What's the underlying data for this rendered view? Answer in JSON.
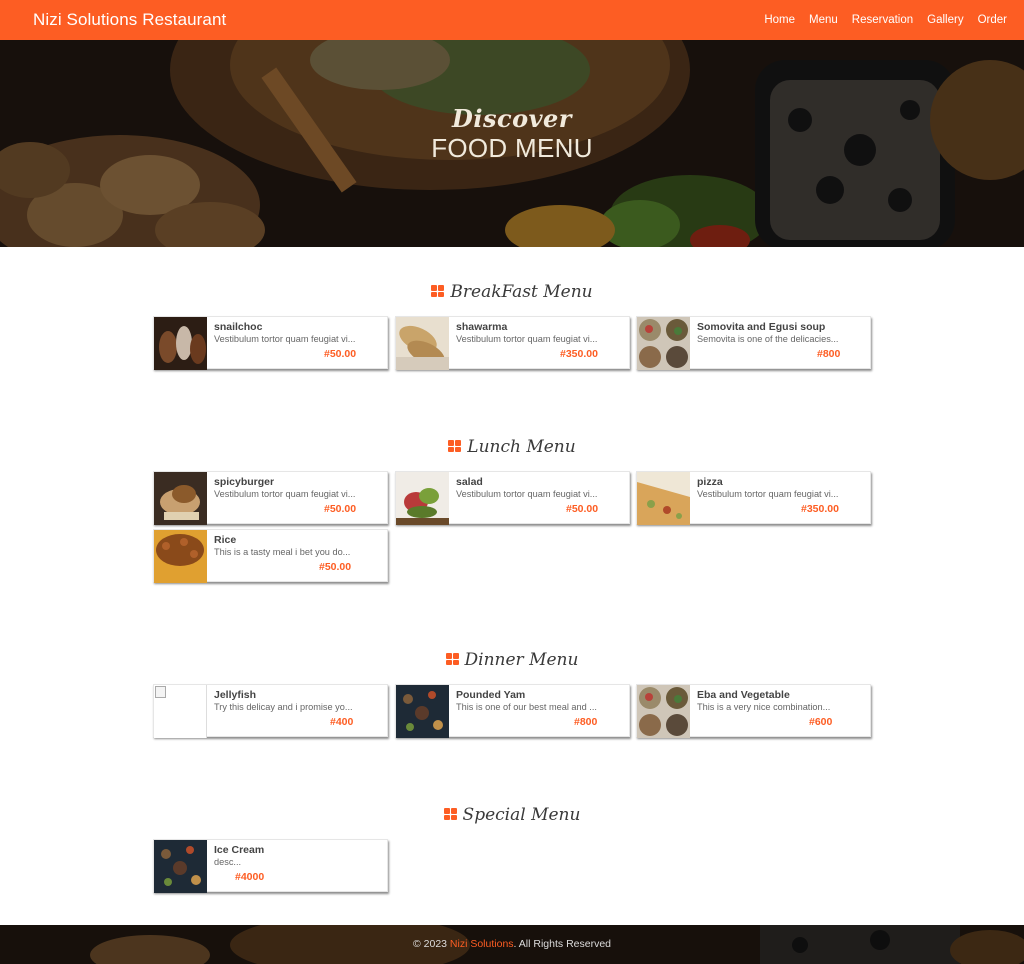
{
  "nav": {
    "brand": "Nizi Solutions Restaurant",
    "links": [
      "Home",
      "Menu",
      "Reservation",
      "Gallery",
      "Order"
    ]
  },
  "hero": {
    "script": "Discover",
    "title": "FOOD MENU"
  },
  "icons": {
    "section": "grid-icon",
    "broken_image": "broken-image-icon"
  },
  "colors": {
    "accent": "#fd5d23",
    "text": "#444444"
  },
  "sections": [
    {
      "title": "BreakFast Menu",
      "items": [
        {
          "name": "snailchoc",
          "desc": "Vestibulum tortor quam feugiat vi...",
          "price": "#50.00"
        },
        {
          "name": "shawarma",
          "desc": "Vestibulum tortor quam feugiat vi...",
          "price": "#350.00"
        },
        {
          "name": "Somovita and Egusi soup",
          "desc": "Semovita is one of the delicacies...",
          "price": "#800"
        }
      ]
    },
    {
      "title": "Lunch Menu",
      "items": [
        {
          "name": "spicyburger",
          "desc": "Vestibulum tortor quam feugiat vi...",
          "price": "#50.00"
        },
        {
          "name": "salad",
          "desc": "Vestibulum tortor quam feugiat vi...",
          "price": "#50.00"
        },
        {
          "name": "pizza",
          "desc": "Vestibulum tortor quam feugiat vi...",
          "price": "#350.00"
        },
        {
          "name": "Rice",
          "desc": "This is a tasty meal i bet you do...",
          "price": "#50.00"
        }
      ]
    },
    {
      "title": "Dinner Menu",
      "items": [
        {
          "name": "Jellyfish",
          "desc": "Try this delicay and i promise yo...",
          "price": "#400"
        },
        {
          "name": "Pounded Yam",
          "desc": "This is one of our best meal and ...",
          "price": "#800"
        },
        {
          "name": "Eba and Vegetable",
          "desc": "This is a very nice combination...",
          "price": "#600"
        }
      ]
    },
    {
      "title": "Special Menu",
      "items": [
        {
          "name": "Ice Cream",
          "desc": "desc...",
          "price": "#4000"
        }
      ]
    }
  ],
  "footer": {
    "prefix": "© 2023 ",
    "company": "Nizi Solutions",
    "suffix": ". All Rights Reserved"
  }
}
